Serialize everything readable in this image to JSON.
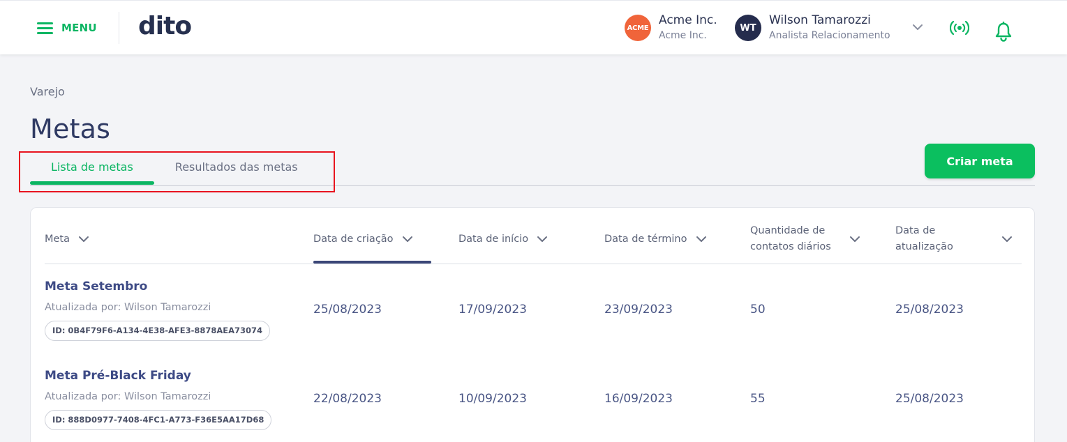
{
  "header": {
    "menu_label": "MENU",
    "logo_text": "dito",
    "org": {
      "avatar_text": "ACME",
      "name": "Acme Inc.",
      "sub": "Acme Inc."
    },
    "user": {
      "initials": "WT",
      "name": "Wilson Tamarozzi",
      "role": "Analista Relacionamento"
    },
    "icons": [
      "hamburger-icon",
      "chevron-down-icon",
      "broadcast-icon",
      "bell-icon"
    ]
  },
  "page": {
    "breadcrumb": "Varejo",
    "title": "Metas"
  },
  "tabs": [
    {
      "label": "Lista de metas",
      "active": true
    },
    {
      "label": "Resultados das metas",
      "active": false
    }
  ],
  "create_button_label": "Criar meta",
  "table": {
    "columns": [
      {
        "label": "Meta"
      },
      {
        "label": "Data de criação",
        "sorted": true
      },
      {
        "label": "Data de início"
      },
      {
        "label": "Data de término"
      },
      {
        "label": "Quantidade de contatos diários"
      },
      {
        "label": "Data de atualização"
      }
    ],
    "rows": [
      {
        "name": "Meta Setembro",
        "updated_by": "Atualizada por: Wilson Tamarozzi",
        "id": "ID: 0B4F79F6-A134-4E38-AFE3-8878AEA73074",
        "created": "25/08/2023",
        "start": "17/09/2023",
        "end": "23/09/2023",
        "daily_contacts": "50",
        "updated": "25/08/2023"
      },
      {
        "name": "Meta Pré-Black Friday",
        "updated_by": "Atualizada por: Wilson Tamarozzi",
        "id": "ID: 888D0977-7408-4FC1-A773-F36E5AA17D68",
        "created": "22/08/2023",
        "start": "10/09/2023",
        "end": "16/09/2023",
        "daily_contacts": "55",
        "updated": "25/08/2023"
      }
    ]
  },
  "colors": {
    "accent": "#0bb562",
    "button": "#0bbf5f",
    "title": "#2f3a63",
    "highlight": "#e8141f",
    "acme": "#f0643a",
    "avatar_dark": "#252c4d"
  }
}
